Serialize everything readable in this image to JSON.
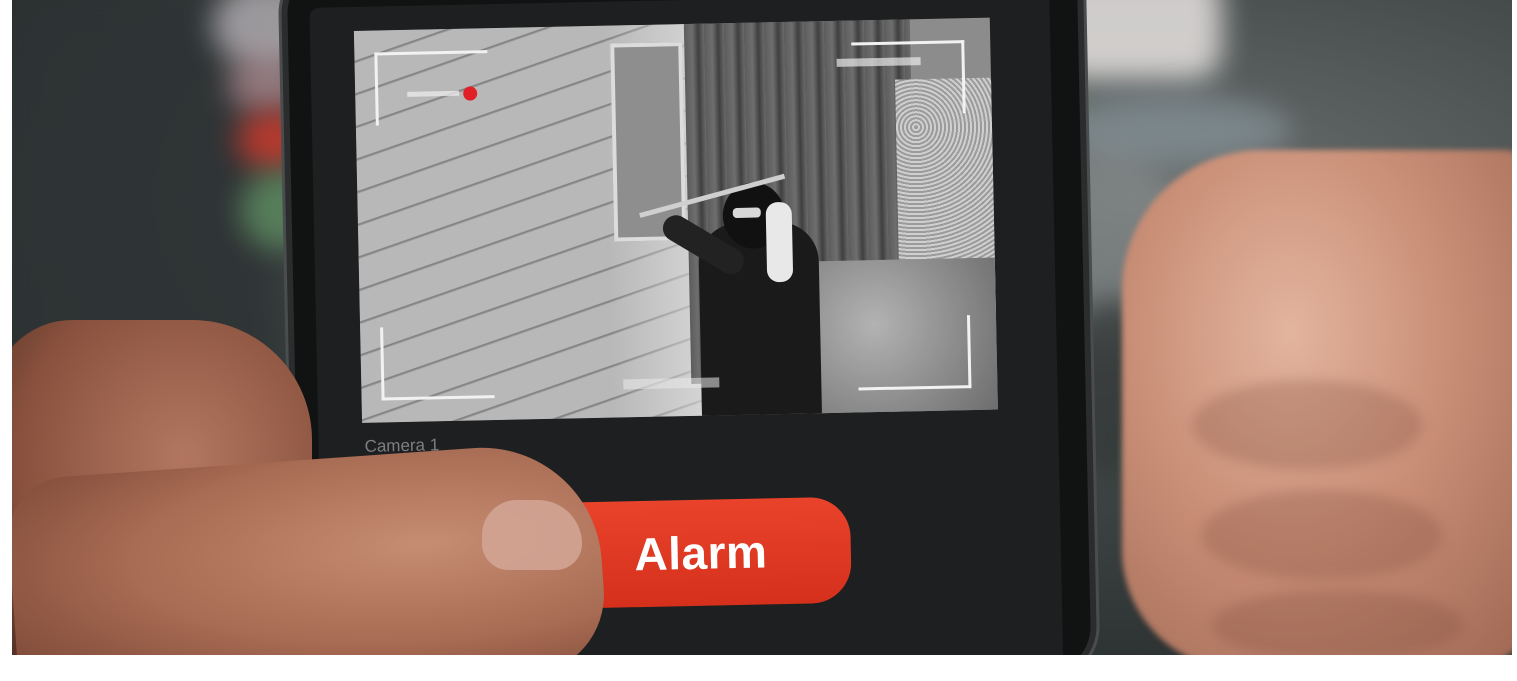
{
  "camera": {
    "label": "Camera 1",
    "recording_color": "#e01f26"
  },
  "actions": {
    "alarm_label": "Alarm",
    "alarm_color": "#e03a25"
  }
}
